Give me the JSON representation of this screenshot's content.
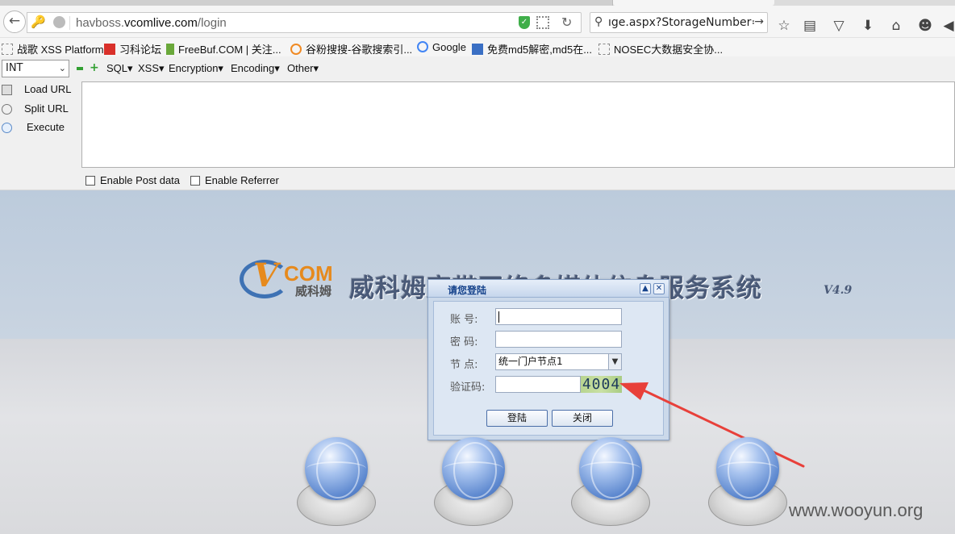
{
  "browser": {
    "url_host": "havboss.",
    "url_domain": "vcomlive.com",
    "url_path": "/login",
    "search_text": "ıge.aspx?StorageNumber=",
    "toolbar_icons": [
      "star-icon",
      "reading-list-icon",
      "pocket-icon",
      "download-icon",
      "home-icon",
      "smiley-icon",
      "extension-icon"
    ]
  },
  "bookmarks": [
    {
      "label": "战歌 XSS Platform",
      "icon": "page-icon"
    },
    {
      "label": "习科论坛",
      "icon": "slc-icon"
    },
    {
      "label": "FreeBuf.COM | 关注...",
      "icon": "freebuf-icon"
    },
    {
      "label": "谷粉搜搜-谷歌搜索引...",
      "icon": "g-icon"
    },
    {
      "label": "Google",
      "icon": "google-icon"
    },
    {
      "label": "免费md5解密,md5在...",
      "icon": "md5-icon"
    },
    {
      "label": "NOSEC大数据安全协...",
      "icon": "page-icon"
    }
  ],
  "hackbar": {
    "select_value": "INT",
    "menus": [
      "SQL",
      "XSS",
      "Encryption",
      "Encoding",
      "Other"
    ],
    "load_url": "Load URL",
    "split_url": "Split URL",
    "execute": "Execute",
    "enable_post": "Enable Post data",
    "enable_referrer": "Enable Referrer"
  },
  "page": {
    "logo_com": "COM",
    "logo_cn": "威科姆",
    "system_title": "威科姆宽带网络多媒体信息服务系统",
    "version": "V4.9"
  },
  "dialog": {
    "title": "请您登陆",
    "account_label": "账   号:",
    "password_label": "密   码:",
    "node_label": "节   点:",
    "node_value": "统一门户节点1",
    "captcha_label": "验证码:",
    "captcha_value": "4004",
    "login_button": "登陆",
    "close_button": "关闭"
  },
  "watermark": "www.wooyun.org",
  "colors": {
    "accent_arrow": "#e8403a",
    "dialog_title": "#15428b",
    "banner": "#bccbdc"
  }
}
